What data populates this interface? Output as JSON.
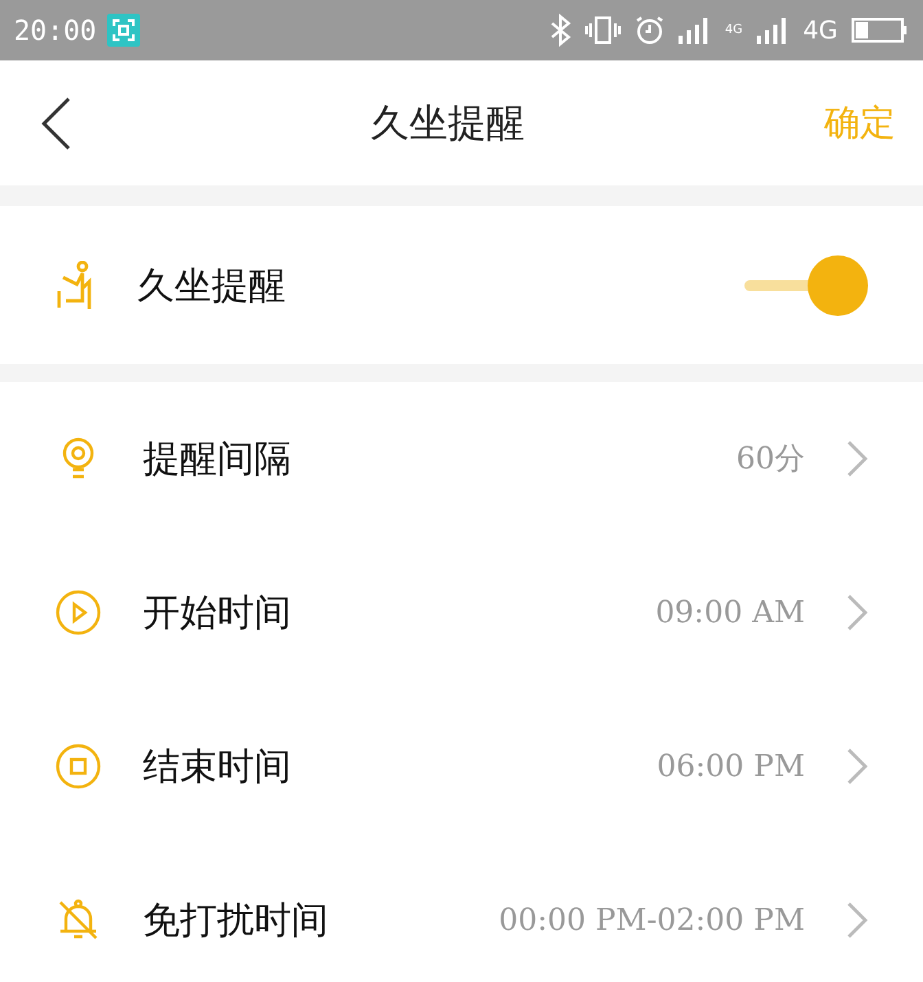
{
  "status_bar": {
    "time": "20:00",
    "network": "4G",
    "network_small": "4G"
  },
  "header": {
    "title": "久坐提醒",
    "confirm": "确定"
  },
  "reminder_toggle": {
    "label": "久坐提醒",
    "on": true
  },
  "settings": [
    {
      "label": "提醒间隔",
      "value": "60分"
    },
    {
      "label": "开始时间",
      "value": "09:00 AM"
    },
    {
      "label": "结束时间",
      "value": "06:00 PM"
    },
    {
      "label": "免打扰时间",
      "value": "00:00 PM-02:00 PM"
    }
  ]
}
